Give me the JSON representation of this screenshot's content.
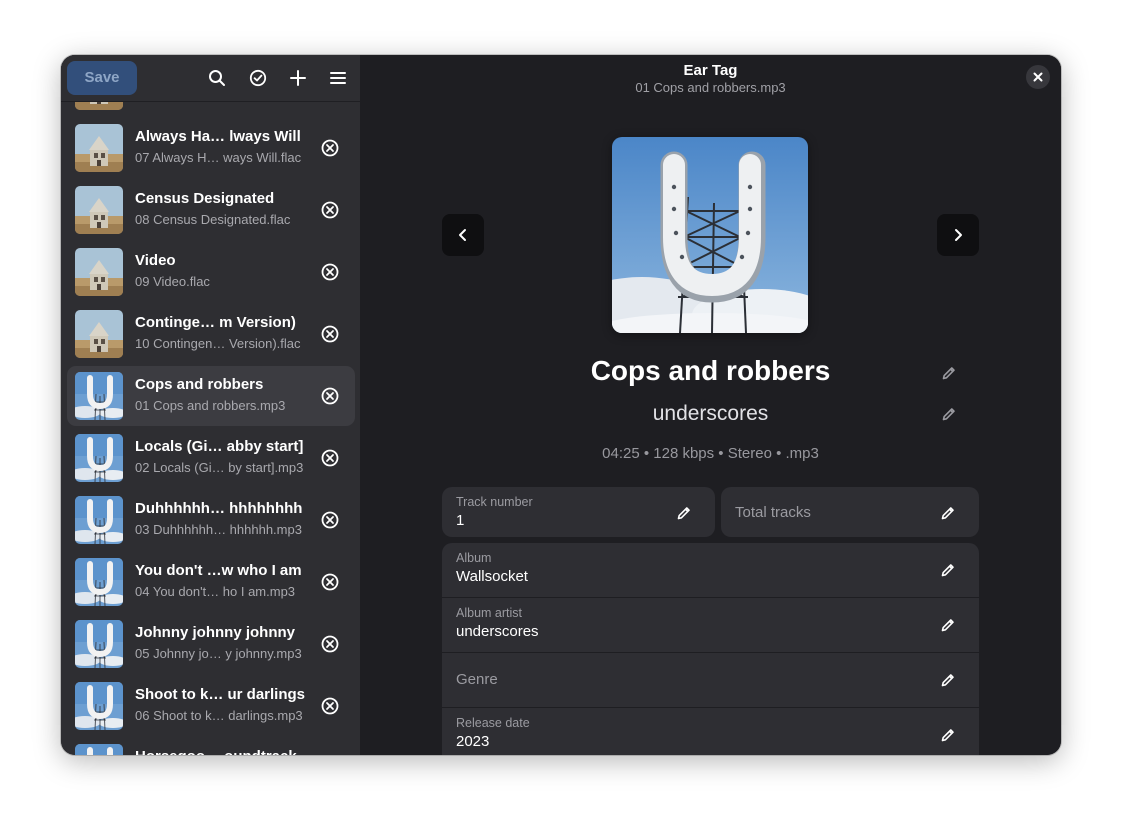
{
  "window": {
    "title": "Ear Tag",
    "subtitle": "01 Cops and robbers.mp3"
  },
  "sidebar": {
    "save_label": "Save",
    "header_icons": [
      "search-icon",
      "select-all-icon",
      "add-icon",
      "menu-icon"
    ],
    "tracks": [
      {
        "title": "Always Ha… lways Will",
        "file": "07 Always H… ways Will.flac",
        "cover": "house"
      },
      {
        "title": "Census Designated",
        "file": "08 Census Designated.flac",
        "cover": "house"
      },
      {
        "title": "Video",
        "file": "09 Video.flac",
        "cover": "house"
      },
      {
        "title": "Continge…  m Version)",
        "file": "10 Contingen…  Version).flac",
        "cover": "house"
      },
      {
        "title": "Cops and robbers",
        "file": "01 Cops and robbers.mp3",
        "cover": "horseshoe",
        "selected": true
      },
      {
        "title": "Locals (Gi… abby start]",
        "file": "02 Locals (Gi… by start].mp3",
        "cover": "horseshoe"
      },
      {
        "title": "Duhhhhhh… hhhhhhhh",
        "file": "03 Duhhhhhh… hhhhhh.mp3",
        "cover": "horseshoe"
      },
      {
        "title": "You don't …w who I am",
        "file": "04 You don't…  ho I am.mp3",
        "cover": "horseshoe"
      },
      {
        "title": "Johnny johnny johnny",
        "file": "05 Johnny jo… y johnny.mp3",
        "cover": "horseshoe"
      },
      {
        "title": "Shoot to k… ur darlings",
        "file": "06 Shoot to k… darlings.mp3",
        "cover": "horseshoe"
      },
      {
        "title": "Horsegoo… oundtrack",
        "file": "",
        "cover": "horseshoe"
      }
    ]
  },
  "main": {
    "song_title": "Cops and robbers",
    "song_artist": "underscores",
    "meta": "04:25 • 128 kbps • Stereo • .mp3",
    "fields": {
      "track_number": {
        "label": "Track number",
        "value": "1"
      },
      "total_tracks": {
        "placeholder": "Total tracks"
      },
      "album": {
        "label": "Album",
        "value": "Wallsocket"
      },
      "album_artist": {
        "label": "Album artist",
        "value": "underscores"
      },
      "genre": {
        "placeholder": "Genre"
      },
      "release_date": {
        "label": "Release date",
        "value": "2023"
      }
    }
  },
  "colors": {
    "accent": "#324f7b",
    "sidebar_bg": "#2e2e32",
    "main_bg": "#1e1e22",
    "card_bg": "#2e2e33"
  }
}
